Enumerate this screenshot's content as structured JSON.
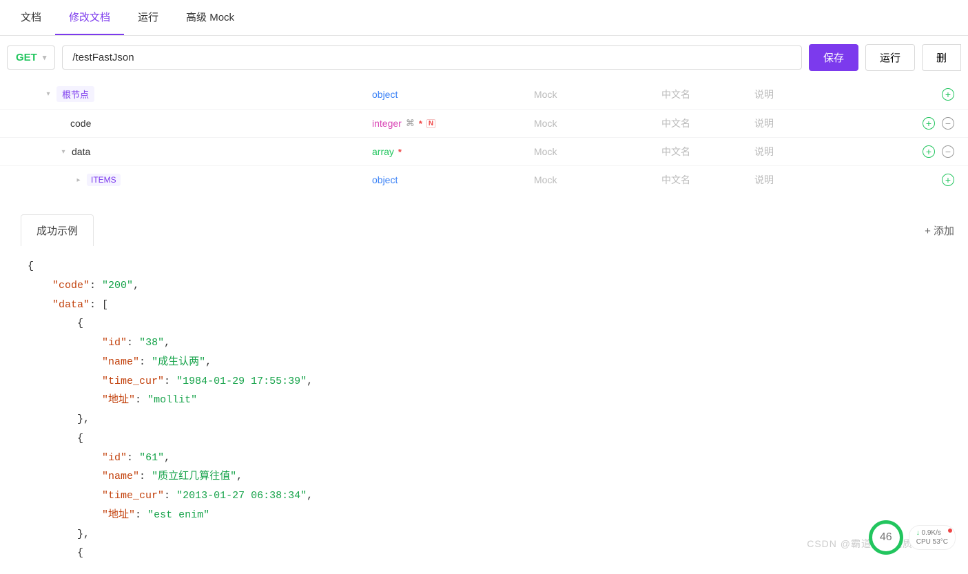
{
  "tabs": {
    "doc": "文档",
    "edit_doc": "修改文档",
    "run": "运行",
    "mock": "高级 Mock"
  },
  "request": {
    "method": "GET",
    "url": "/testFastJson"
  },
  "actions": {
    "save": "保存",
    "run": "运行",
    "delete": "删"
  },
  "schema": {
    "placeholders": {
      "mock": "Mock",
      "cn": "中文名",
      "desc": "说明"
    },
    "root": {
      "name": "根节点",
      "type": "object"
    },
    "code": {
      "name": "code",
      "type": "integer",
      "required": true,
      "nullable": "N"
    },
    "data": {
      "name": "data",
      "type": "array",
      "required": true
    },
    "items": {
      "name": "ITEMS",
      "type": "object"
    }
  },
  "example": {
    "tab": "成功示例",
    "add": "+ 添加",
    "json": {
      "code": "200",
      "data": [
        {
          "id": "38",
          "name": "成生认两",
          "time_cur": "1984-01-29 17:55:39",
          "地址": "mollit"
        },
        {
          "id": "61",
          "name": "质立红几算往值",
          "time_cur": "2013-01-27 06:38:34",
          "地址": "est enim"
        }
      ]
    }
  },
  "overlay": {
    "gauge": "46",
    "net_down": "0.9K/s",
    "cpu": "CPU 53°C",
    "watermark": "CSDN @霸道流氓气质"
  }
}
